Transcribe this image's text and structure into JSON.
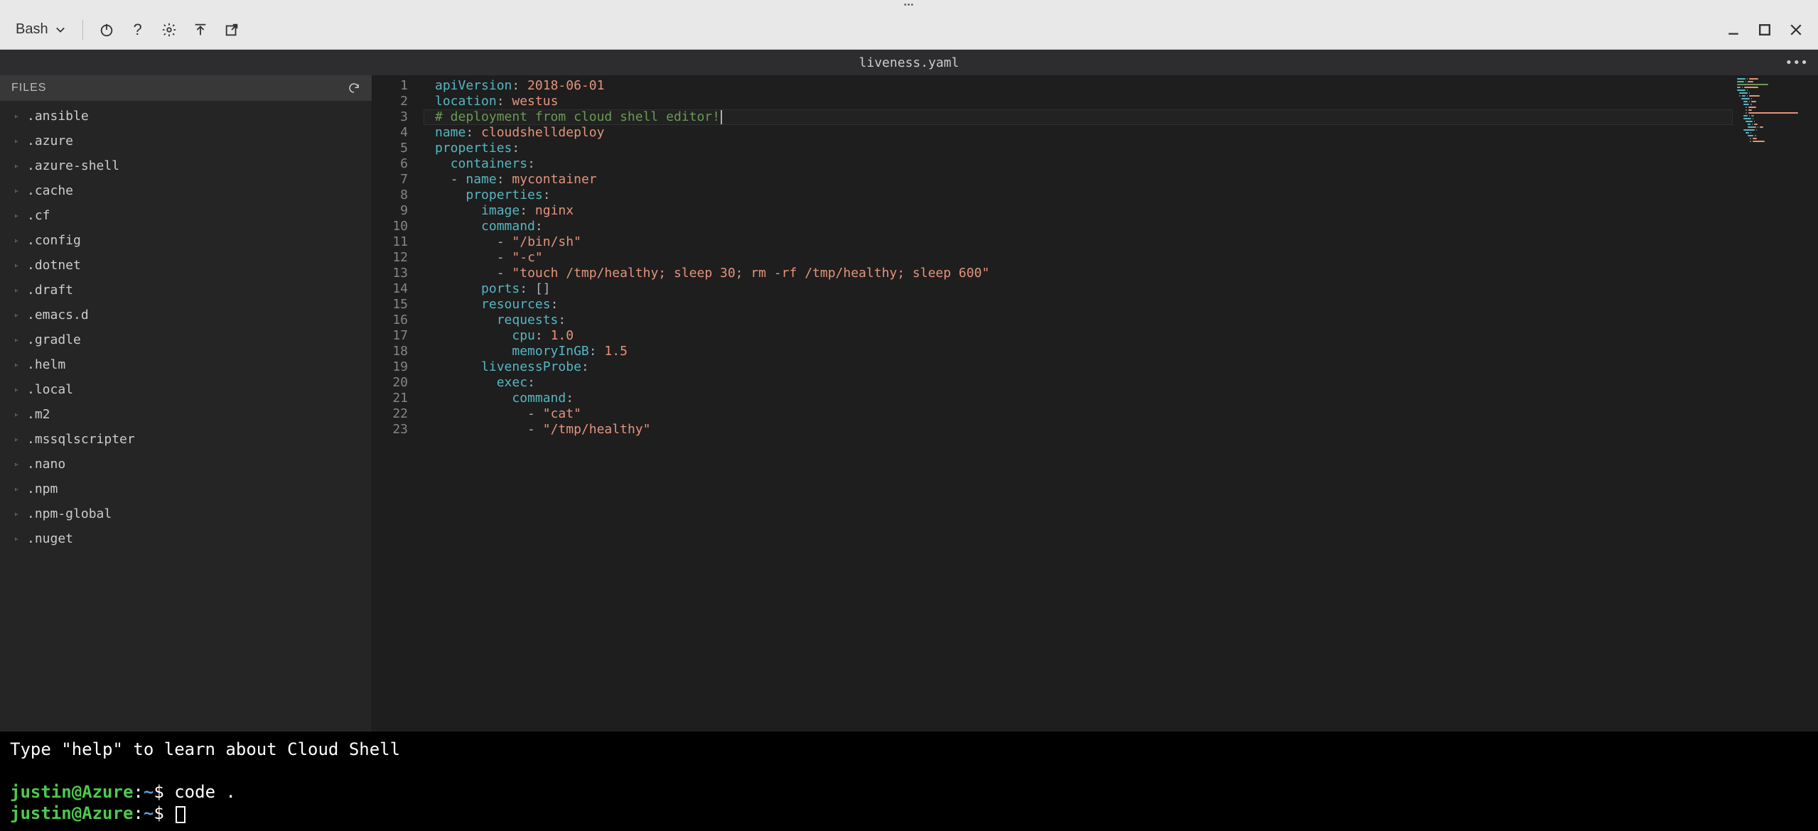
{
  "toolbar": {
    "shell_label": "Bash",
    "icons": {
      "power": "power-icon",
      "help": "help-icon",
      "settings": "gear-icon",
      "upload": "upload-icon",
      "newwin": "new-window-icon",
      "minimize": "minimize-icon",
      "maximize": "maximize-icon",
      "close": "close-icon"
    }
  },
  "editor": {
    "tab_title": "liveness.yaml",
    "files_header": "FILES",
    "file_tree": [
      ".ansible",
      ".azure",
      ".azure-shell",
      ".cache",
      ".cf",
      ".config",
      ".dotnet",
      ".draft",
      ".emacs.d",
      ".gradle",
      ".helm",
      ".local",
      ".m2",
      ".mssqlscripter",
      ".nano",
      ".npm",
      ".npm-global",
      ".nuget"
    ],
    "code_lines": [
      {
        "n": 1,
        "indent": 0,
        "tokens": [
          [
            "key",
            "apiVersion"
          ],
          [
            "punc",
            ":"
          ],
          [
            "str",
            " 2018-06-01"
          ]
        ]
      },
      {
        "n": 2,
        "indent": 0,
        "tokens": [
          [
            "key",
            "location"
          ],
          [
            "punc",
            ":"
          ],
          [
            "str",
            " westus"
          ]
        ]
      },
      {
        "n": 3,
        "indent": 0,
        "current": true,
        "tokens": [
          [
            "comment",
            "# deployment from cloud shell editor!"
          ]
        ],
        "cursor_after": true
      },
      {
        "n": 4,
        "indent": 0,
        "tokens": [
          [
            "key",
            "name"
          ],
          [
            "punc",
            ":"
          ],
          [
            "str",
            " cloudshelldeploy"
          ]
        ]
      },
      {
        "n": 5,
        "indent": 0,
        "tokens": [
          [
            "key",
            "properties"
          ],
          [
            "punc",
            ":"
          ]
        ]
      },
      {
        "n": 6,
        "indent": 1,
        "tokens": [
          [
            "key",
            "containers"
          ],
          [
            "punc",
            ":"
          ]
        ]
      },
      {
        "n": 7,
        "indent": 1,
        "tokens": [
          [
            "dash",
            "- "
          ],
          [
            "key",
            "name"
          ],
          [
            "punc",
            ":"
          ],
          [
            "str",
            " mycontainer"
          ]
        ]
      },
      {
        "n": 8,
        "indent": 2,
        "tokens": [
          [
            "key",
            "properties"
          ],
          [
            "punc",
            ":"
          ]
        ]
      },
      {
        "n": 9,
        "indent": 3,
        "tokens": [
          [
            "key",
            "image"
          ],
          [
            "punc",
            ":"
          ],
          [
            "str",
            " nginx"
          ]
        ]
      },
      {
        "n": 10,
        "indent": 3,
        "tokens": [
          [
            "key",
            "command"
          ],
          [
            "punc",
            ":"
          ]
        ]
      },
      {
        "n": 11,
        "indent": 4,
        "tokens": [
          [
            "dash",
            "- "
          ],
          [
            "str",
            "\"/bin/sh\""
          ]
        ]
      },
      {
        "n": 12,
        "indent": 4,
        "tokens": [
          [
            "dash",
            "- "
          ],
          [
            "str",
            "\"-c\""
          ]
        ]
      },
      {
        "n": 13,
        "indent": 4,
        "tokens": [
          [
            "dash",
            "- "
          ],
          [
            "str",
            "\"touch /tmp/healthy; sleep 30; rm -rf /tmp/healthy; sleep 600\""
          ]
        ]
      },
      {
        "n": 14,
        "indent": 3,
        "tokens": [
          [
            "key",
            "ports"
          ],
          [
            "punc",
            ":"
          ],
          [
            "punc",
            " []"
          ]
        ]
      },
      {
        "n": 15,
        "indent": 3,
        "tokens": [
          [
            "key",
            "resources"
          ],
          [
            "punc",
            ":"
          ]
        ]
      },
      {
        "n": 16,
        "indent": 4,
        "tokens": [
          [
            "key",
            "requests"
          ],
          [
            "punc",
            ":"
          ]
        ]
      },
      {
        "n": 17,
        "indent": 5,
        "tokens": [
          [
            "key",
            "cpu"
          ],
          [
            "punc",
            ":"
          ],
          [
            "num",
            " 1.0"
          ]
        ]
      },
      {
        "n": 18,
        "indent": 5,
        "tokens": [
          [
            "key",
            "memoryInGB"
          ],
          [
            "punc",
            ":"
          ],
          [
            "num",
            " 1.5"
          ]
        ]
      },
      {
        "n": 19,
        "indent": 3,
        "tokens": [
          [
            "key",
            "livenessProbe"
          ],
          [
            "punc",
            ":"
          ]
        ]
      },
      {
        "n": 20,
        "indent": 4,
        "tokens": [
          [
            "key",
            "exec"
          ],
          [
            "punc",
            ":"
          ]
        ]
      },
      {
        "n": 21,
        "indent": 5,
        "tokens": [
          [
            "key",
            "command"
          ],
          [
            "punc",
            ":"
          ]
        ]
      },
      {
        "n": 22,
        "indent": 6,
        "tokens": [
          [
            "dash",
            "- "
          ],
          [
            "str",
            "\"cat\""
          ]
        ]
      },
      {
        "n": 23,
        "indent": 6,
        "tokens": [
          [
            "dash",
            "- "
          ],
          [
            "str",
            "\"/tmp/healthy\""
          ]
        ]
      }
    ]
  },
  "terminal": {
    "hint": "Type \"help\" to learn about Cloud Shell",
    "lines": [
      {
        "user": "justin",
        "host": "Azure",
        "path": "~",
        "cmd": "code ."
      },
      {
        "user": "justin",
        "host": "Azure",
        "path": "~",
        "cmd": "",
        "cursor": true
      }
    ]
  }
}
